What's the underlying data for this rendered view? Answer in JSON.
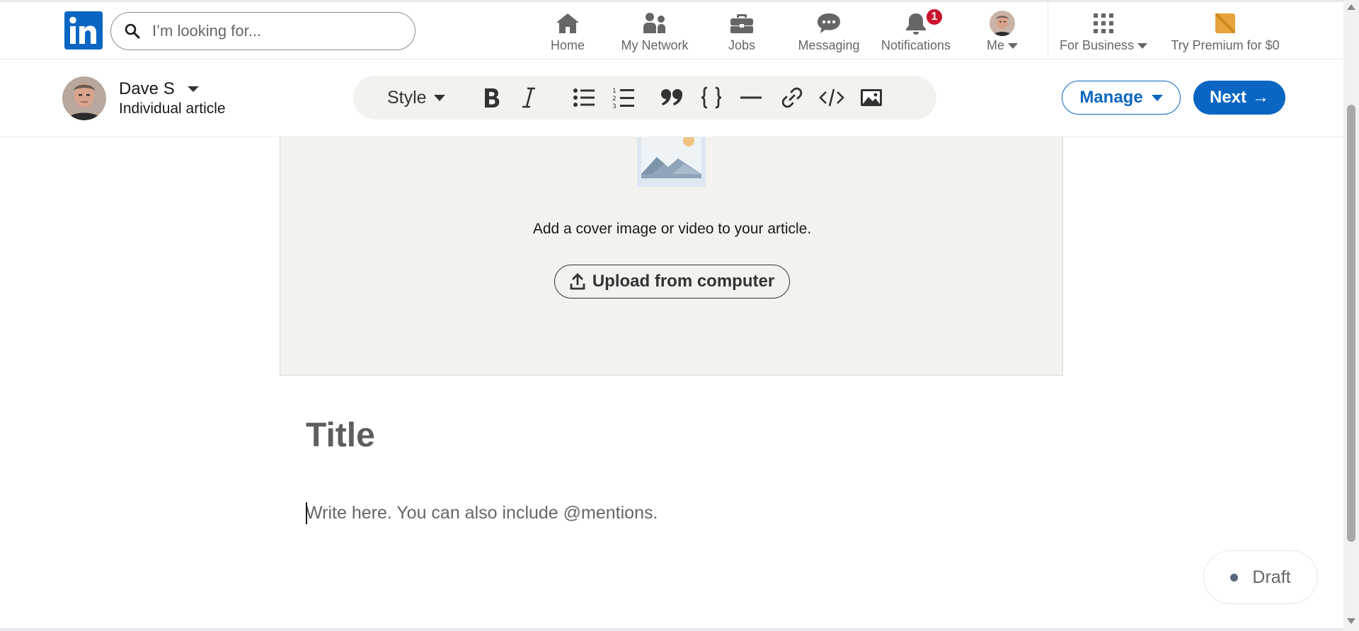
{
  "nav": {
    "search_placeholder": "I’m looking for...",
    "items": [
      {
        "label": "Home",
        "icon": "home-icon"
      },
      {
        "label": "My Network",
        "icon": "network-icon"
      },
      {
        "label": "Jobs",
        "icon": "briefcase-icon"
      },
      {
        "label": "Messaging",
        "icon": "messaging-icon"
      },
      {
        "label": "Notifications",
        "icon": "bell-icon",
        "badge": "1"
      },
      {
        "label": "Me",
        "icon": "avatar"
      },
      {
        "label": "For Business",
        "icon": "grid-icon"
      },
      {
        "label": "Try Premium for $0",
        "icon": "premium-icon"
      }
    ]
  },
  "editor": {
    "author_name": "Dave S",
    "author_subtitle": "Individual article",
    "toolbar": {
      "style_label": "Style",
      "buttons": [
        "bold-icon",
        "italic-icon",
        "bulleted-list-icon",
        "numbered-list-icon",
        "quote-icon",
        "code-block-icon",
        "divider-icon",
        "link-icon",
        "embed-icon",
        "image-icon"
      ]
    },
    "manage_label": "Manage",
    "next_label": "Next",
    "next_arrow": "→"
  },
  "cover": {
    "text": "Add a cover image or video to your article.",
    "upload_label": "Upload from computer"
  },
  "article": {
    "title_placeholder": "Title",
    "body_placeholder": "Write here. You can also include @mentions."
  },
  "status": {
    "draft_label": "Draft"
  },
  "colors": {
    "brand": "#0a66c2",
    "badge": "#cb112d",
    "toolbar_bg": "#f3f2ef"
  }
}
